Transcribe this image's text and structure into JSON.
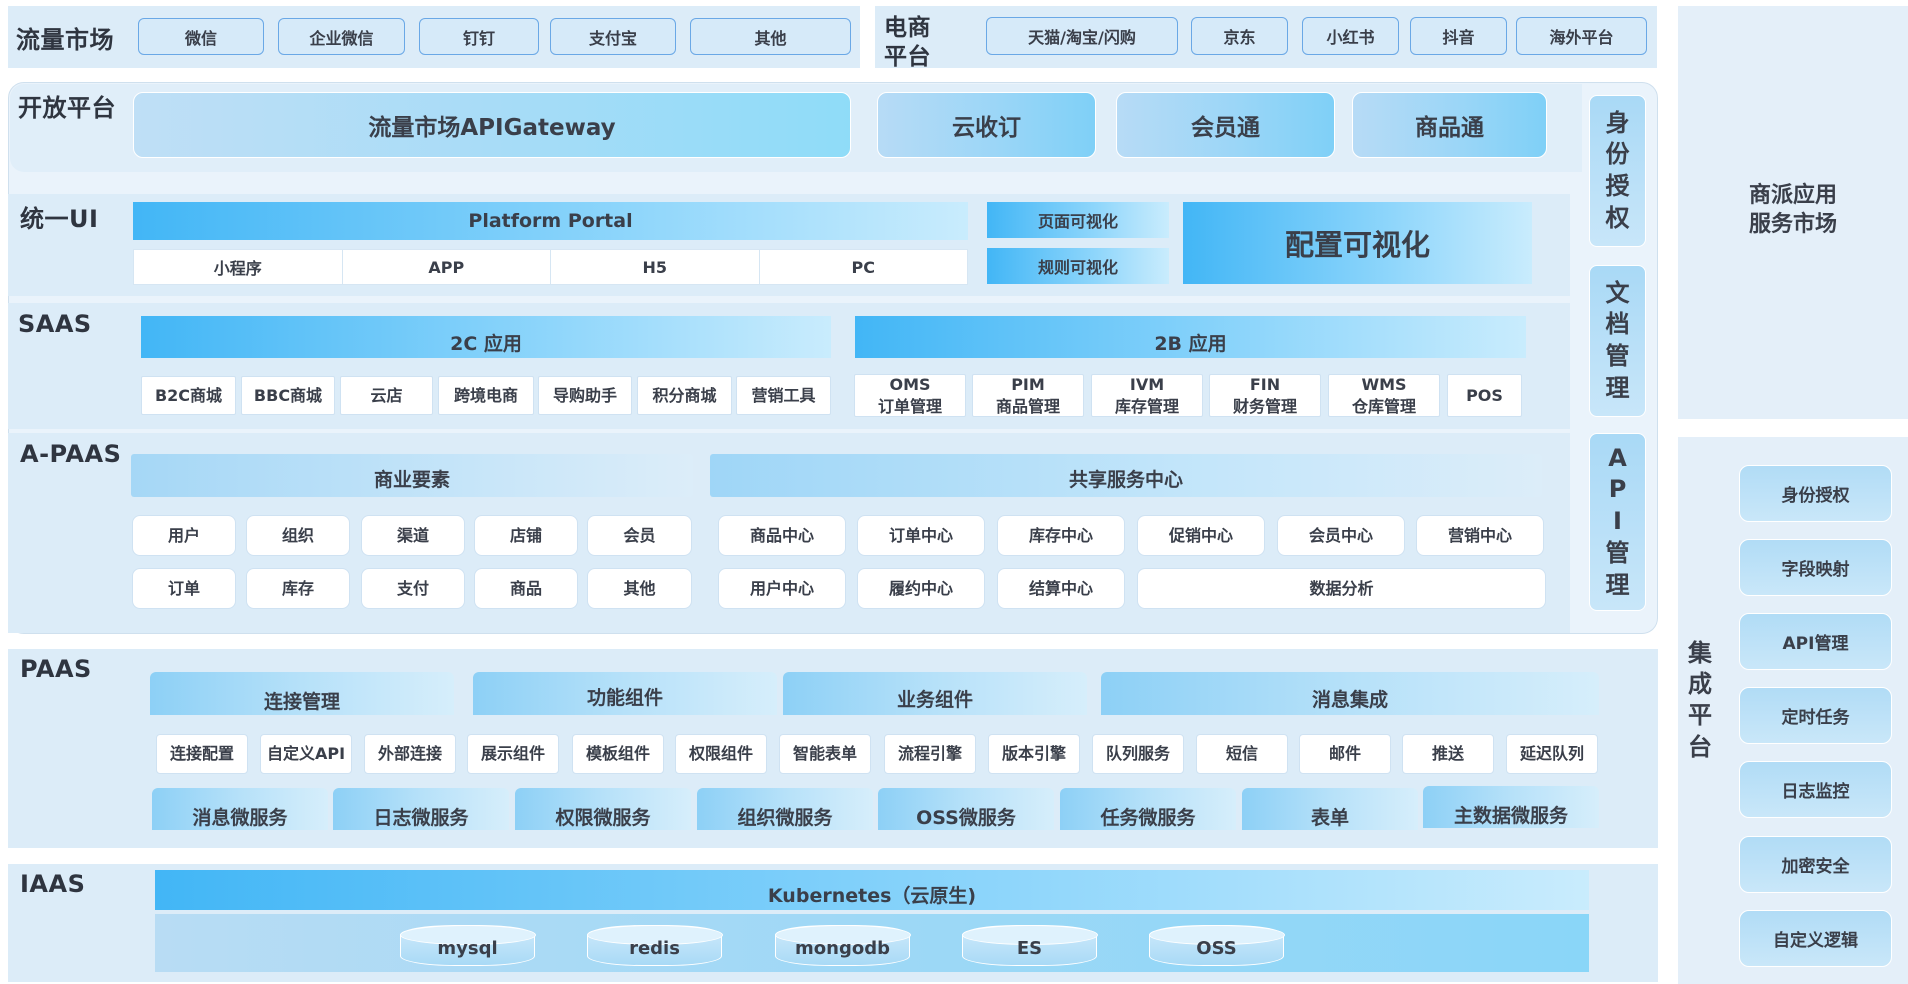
{
  "traffic_market": {
    "title": "流量市场",
    "items": [
      "微信",
      "企业微信",
      "钉钉",
      "支付宝",
      "其他"
    ]
  },
  "ecommerce": {
    "title_line1": "电商",
    "title_line2": "平台",
    "items": [
      "天猫/淘宝/闪购",
      "京东",
      "小红书",
      "抖音",
      "海外平台"
    ]
  },
  "open_platform": {
    "title": "开放平台",
    "gateway": "流量市场APIGateway",
    "items": [
      "云收订",
      "会员通",
      "商品通"
    ]
  },
  "right_vertical": [
    [
      "身",
      "份",
      "授",
      "权"
    ],
    [
      "文",
      "档",
      "管",
      "理"
    ],
    [
      "A",
      "P",
      "I",
      "管",
      "理"
    ]
  ],
  "unified_ui": {
    "title": "统一UI",
    "portal": "Platform Portal",
    "clients": [
      "小程序",
      "APP",
      "H5",
      "PC"
    ],
    "page_visual": "页面可视化",
    "rule_visual": "规则可视化",
    "config_visual": "配置可视化"
  },
  "saas": {
    "title": "SAAS",
    "c_title": "2C 应用",
    "c_items": [
      "B2C商城",
      "BBC商城",
      "云店",
      "跨境电商",
      "导购助手",
      "积分商城",
      "营销工具"
    ],
    "b_title": "2B 应用",
    "b_items": [
      {
        "code": "OMS",
        "label": "订单管理"
      },
      {
        "code": "PIM",
        "label": "商品管理"
      },
      {
        "code": "IVM",
        "label": "库存管理"
      },
      {
        "code": "FIN",
        "label": "财务管理"
      },
      {
        "code": "WMS",
        "label": "仓库管理"
      },
      {
        "code": "POS",
        "label": ""
      }
    ]
  },
  "apaas": {
    "title": "A-PAAS",
    "biz_title": "商业要素",
    "biz_row1": [
      "用户",
      "组织",
      "渠道",
      "店铺",
      "会员"
    ],
    "biz_row2": [
      "订单",
      "库存",
      "支付",
      "商品",
      "其他"
    ],
    "shared_title": "共享服务中心",
    "shared_row1": [
      "商品中心",
      "订单中心",
      "库存中心",
      "促销中心",
      "会员中心",
      "营销中心"
    ],
    "shared_row2": [
      "用户中心",
      "履约中心",
      "结算中心",
      "数据分析"
    ]
  },
  "paas": {
    "title": "PAAS",
    "tabs": [
      "连接管理",
      "功能组件",
      "业务组件",
      "消息集成"
    ],
    "components": [
      "连接配置",
      "自定义API",
      "外部连接",
      "展示组件",
      "模板组件",
      "权限组件",
      "智能表单",
      "流程引擎",
      "版本引擎",
      "队列服务",
      "短信",
      "邮件",
      "推送",
      "延迟队列"
    ],
    "microservices": [
      "消息微服务",
      "日志微服务",
      "权限微服务",
      "组织微服务",
      "OSS微服务",
      "任务微服务",
      "表单",
      "主数据微服务"
    ]
  },
  "iaas": {
    "title": "IAAS",
    "k8s": "Kubernetes（云原生)",
    "dbs": [
      "mysql",
      "redis",
      "mongodb",
      "ES",
      "OSS"
    ]
  },
  "app_market": {
    "line1": "商派应用",
    "line2": "服务市场"
  },
  "integration": {
    "title": [
      "集",
      "成",
      "平",
      "台"
    ],
    "items": [
      "身份授权",
      "字段映射",
      "API管理",
      "定时任务",
      "日志监控",
      "加密安全",
      "自定义逻辑"
    ]
  },
  "colors": {
    "band": "#dcecf8",
    "accent": "#42b6f6",
    "pill_border": "#6aa8e6"
  }
}
